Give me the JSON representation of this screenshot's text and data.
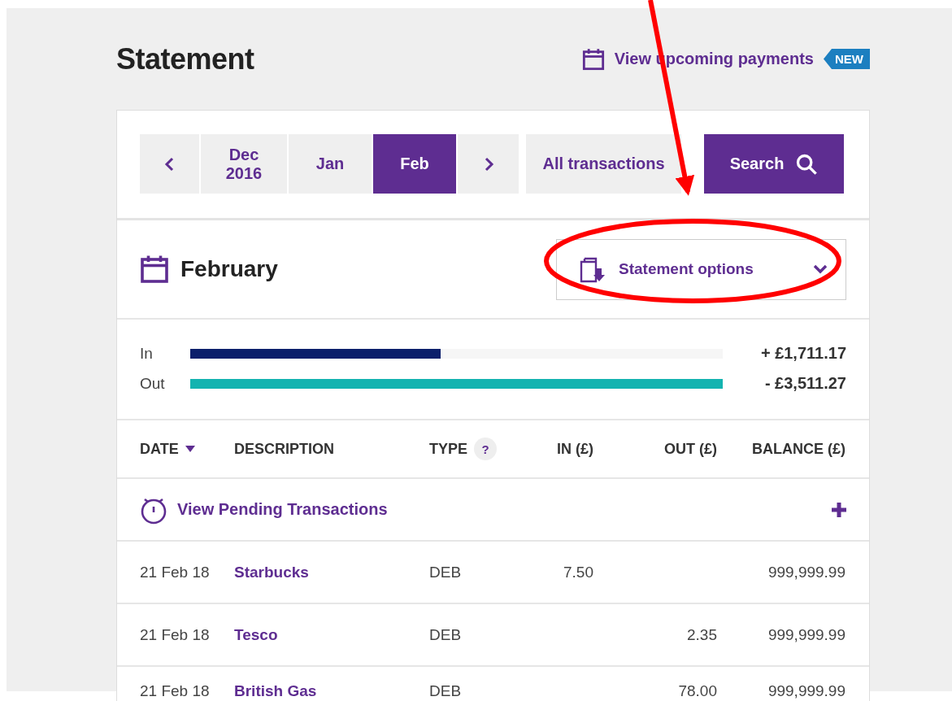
{
  "header": {
    "title": "Statement",
    "upcoming_link": "View upcoming payments",
    "badge": "NEW"
  },
  "period_nav": [
    {
      "kind": "prev",
      "selected": false
    },
    {
      "kind": "month",
      "label": "Dec 2016",
      "selected": false
    },
    {
      "kind": "month",
      "label": "Jan",
      "selected": false
    },
    {
      "kind": "month",
      "label": "Feb",
      "selected": true
    },
    {
      "kind": "next",
      "selected": false
    }
  ],
  "filter": "All transactions",
  "search_button": "Search",
  "period": {
    "title": "February",
    "options_button": "Statement options"
  },
  "summary": [
    {
      "label": "In",
      "kind": "in",
      "level": 0.47,
      "amount": "+ £1,711.17"
    },
    {
      "label": "Out",
      "kind": "out",
      "level": 1,
      "amount": "- £3,511.27"
    }
  ],
  "columns": [
    {
      "label": "DATE",
      "sorted": true
    },
    {
      "label": "DESCRIPTION",
      "sorted": false
    },
    {
      "label": "TYPE",
      "sorted": false,
      "help": "?"
    },
    {
      "label": "IN (£)",
      "sorted": false
    },
    {
      "label": "OUT (£)",
      "sorted": false
    },
    {
      "label": "BALANCE (£)",
      "sorted": false
    }
  ],
  "pending": {
    "label": "View Pending Transactions"
  },
  "rows": [
    {
      "date": "21 Feb 18",
      "description": "Starbucks",
      "type": "DEB",
      "in": "7.50",
      "balance": "999,999.99"
    },
    {
      "date": "21 Feb 18",
      "description": "Tesco",
      "type": "DEB",
      "out": "2.35",
      "balance": "999,999.99"
    },
    {
      "date": "21 Feb 18",
      "description": "British Gas",
      "type": "DEB",
      "out": "78.00",
      "balance": "999,999.99"
    }
  ]
}
